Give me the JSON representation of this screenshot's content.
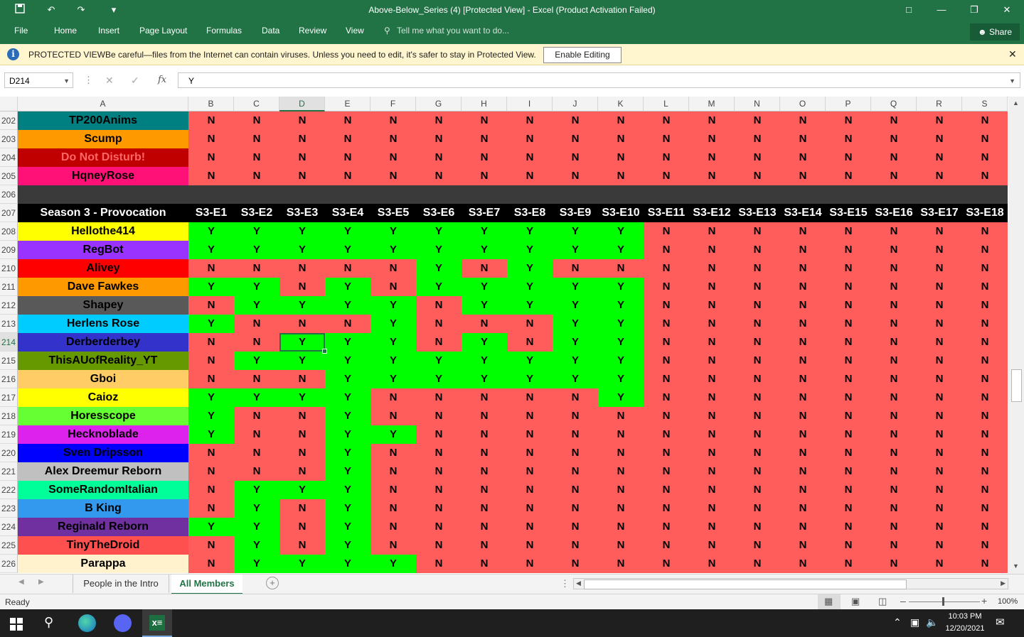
{
  "window": {
    "title": "Above-Below_Series (4)  [Protected View] - Excel (Product Activation Failed)"
  },
  "ribbon": {
    "file": "File",
    "tabs": [
      "Home",
      "Insert",
      "Page Layout",
      "Formulas",
      "Data",
      "Review",
      "View"
    ],
    "tell_me": "Tell me what you want to do...",
    "share": "Share"
  },
  "banner": {
    "label": "PROTECTED VIEW",
    "message": "Be careful—files from the Internet can contain viruses. Unless you need to edit, it's safer to stay in Protected View.",
    "button": "Enable Editing"
  },
  "formula": {
    "name_box": "D214",
    "fx": "fx",
    "value": "Y"
  },
  "colors": {
    "yes": "#00ff00",
    "no": "#ff5c5c",
    "header_bg": "#000000",
    "divider": "#3a3a3a",
    "accent": "#217346"
  },
  "sheet": {
    "columns": [
      "A",
      "B",
      "C",
      "D",
      "E",
      "F",
      "G",
      "H",
      "I",
      "J",
      "K",
      "L",
      "M",
      "N",
      "O",
      "P",
      "Q",
      "R",
      "S"
    ],
    "selected_column": "D",
    "selected_row": "214",
    "header_row": {
      "row": "207",
      "title": "Season 3 - Provocation",
      "episodes": [
        "S3-E1",
        "S3-E2",
        "S3-E3",
        "S3-E4",
        "S3-E5",
        "S3-E6",
        "S3-E7",
        "S3-E8",
        "S3-E9",
        "S3-E10",
        "S3-E11",
        "S3-E12",
        "S3-E13",
        "S3-E14",
        "S3-E15",
        "S3-E16",
        "S3-E17",
        "S3-E18"
      ]
    },
    "divider_row": "206",
    "top_rows": [
      {
        "row": "202",
        "name": "TP200Anims",
        "bg": "#008080",
        "fg": "#000000",
        "cells": "NNNNNNNNNNNNNNNNNN"
      },
      {
        "row": "203",
        "name": "Scump",
        "bg": "#ff9900",
        "fg": "#000000",
        "cells": "NNNNNNNNNNNNNNNNNN"
      },
      {
        "row": "204",
        "name": "Do Not Disturb!",
        "bg": "#c00000",
        "fg": "#ff6666",
        "cells": "NNNNNNNNNNNNNNNNNN"
      },
      {
        "row": "205",
        "name": "HqneyRose",
        "bg": "#ff1177",
        "fg": "#000000",
        "cells": "NNNNNNNNNNNNNNNNNN"
      }
    ],
    "rows": [
      {
        "row": "208",
        "name": "Hellothe414",
        "bg": "#ffff00",
        "fg": "#000000",
        "cells": "YYYYYYYYYYNNNNNNNN"
      },
      {
        "row": "209",
        "name": "RegBot",
        "bg": "#9933ff",
        "fg": "#000000",
        "cells": "YYYYYYYYYYNNNNNNNN"
      },
      {
        "row": "210",
        "name": "Alivey",
        "bg": "#ff0000",
        "fg": "#000000",
        "cells": "NNNNNYNYNNNNNNNNNN"
      },
      {
        "row": "211",
        "name": "Dave Fawkes",
        "bg": "#ff9900",
        "fg": "#000000",
        "cells": "YYNYNYYYYYNNNNNNNN"
      },
      {
        "row": "212",
        "name": "Shapey",
        "bg": "#595959",
        "fg": "#000000",
        "cells": "NYYYYNYYYYNNNNNNNN"
      },
      {
        "row": "213",
        "name": "Herlens Rose",
        "bg": "#00ccff",
        "fg": "#000000",
        "cells": "YNNNYNNNYYNNNNNNNN"
      },
      {
        "row": "214",
        "name": "Derberderbey",
        "bg": "#3333cc",
        "fg": "#000000",
        "cells": "NNYYYNYNYYNNNNNNNN"
      },
      {
        "row": "215",
        "name": "ThisAUofReality_YT",
        "bg": "#669900",
        "fg": "#000000",
        "cells": "NYYYYYYYYYNNNNNNNN"
      },
      {
        "row": "216",
        "name": "Gboi",
        "bg": "#ffcc66",
        "fg": "#000000",
        "cells": "NNNYYYYYYYNNNNNNNN"
      },
      {
        "row": "217",
        "name": "Caioz",
        "bg": "#ffff00",
        "fg": "#000000",
        "cells": "YYYYNNNNNYNNNNNNNN"
      },
      {
        "row": "218",
        "name": "Horesscope",
        "bg": "#66ff33",
        "fg": "#000000",
        "cells": "YNNYNNNNNNNNNNNNNN"
      },
      {
        "row": "219",
        "name": "Hecknoblade",
        "bg": "#dd22ee",
        "fg": "#000000",
        "cells": "YNNYYNNNNNNNNNNNNN"
      },
      {
        "row": "220",
        "name": "Sven Dripsson",
        "bg": "#0000ff",
        "fg": "#000000",
        "cells": "NNNYNNNNNNNNNNNNNN"
      },
      {
        "row": "221",
        "name": "Alex Dreemur Reborn",
        "bg": "#c0c0c0",
        "fg": "#000000",
        "cells": "NNNYNNNNNNNNNNNNNN"
      },
      {
        "row": "222",
        "name": "SomeRandomItalian",
        "bg": "#00ff99",
        "fg": "#000000",
        "cells": "NYYYNNNNNNNNNNNNNN"
      },
      {
        "row": "223",
        "name": "B King",
        "bg": "#3399ee",
        "fg": "#000000",
        "cells": "NYNYNNNNNNNNNNNNNN"
      },
      {
        "row": "224",
        "name": "Reginald Reborn",
        "bg": "#7030a0",
        "fg": "#000000",
        "cells": "YYNYNNNNNNNNNNNNNN"
      },
      {
        "row": "225",
        "name": "TinyTheDroid",
        "bg": "#ff5050",
        "fg": "#000000",
        "cells": "NYNYNNNNNNNNNNNNNN"
      },
      {
        "row": "226",
        "name": "Parappa",
        "bg": "#fff2cc",
        "fg": "#000000",
        "cells": "NYYYYNNNNNNNNNNNNN"
      }
    ]
  },
  "sheet_tabs": [
    "People in the Intro",
    "All Members"
  ],
  "status": {
    "ready": "Ready",
    "zoom": "100%"
  },
  "taskbar": {
    "time": "10:03 PM",
    "date": "12/20/2021"
  }
}
